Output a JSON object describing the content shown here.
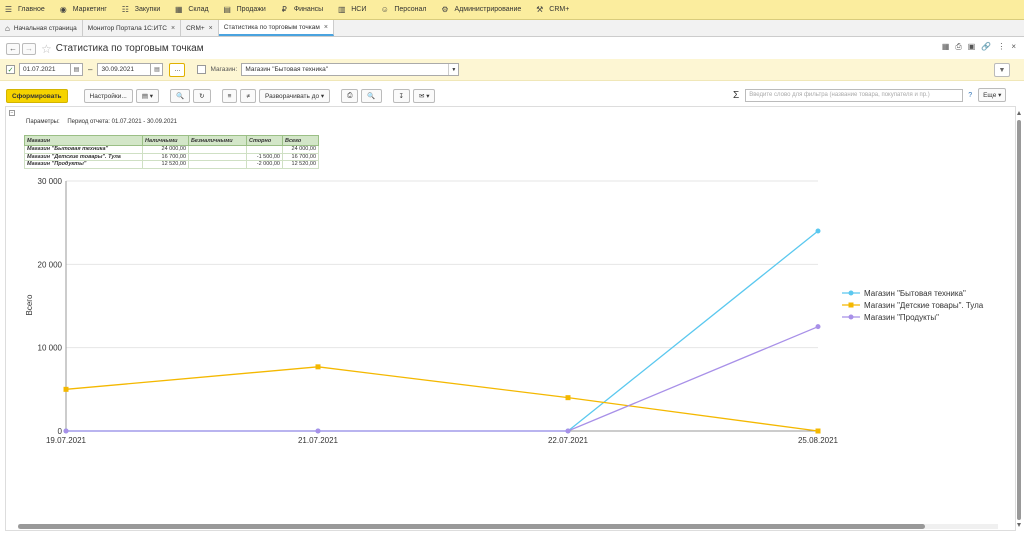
{
  "topmenu": [
    {
      "icon": "menu-icon",
      "label": "Главное"
    },
    {
      "icon": "marketing-icon",
      "label": "Маркетинг"
    },
    {
      "icon": "purchases-icon",
      "label": "Закупки"
    },
    {
      "icon": "warehouse-icon",
      "label": "Склад"
    },
    {
      "icon": "sales-icon",
      "label": "Продажи"
    },
    {
      "icon": "finance-icon",
      "label": "Финансы"
    },
    {
      "icon": "nsi-icon",
      "label": "НСИ"
    },
    {
      "icon": "personnel-icon",
      "label": "Персонал"
    },
    {
      "icon": "admin-icon",
      "label": "Администрирование"
    },
    {
      "icon": "crm-icon",
      "label": "CRM+"
    }
  ],
  "tabs": [
    {
      "label": "Начальная страница",
      "closable": false,
      "home": true
    },
    {
      "label": "Монитор Портала 1С:ИТС",
      "closable": true
    },
    {
      "label": "CRM+",
      "closable": true
    },
    {
      "label": "Статистика по торговым точкам",
      "closable": true,
      "active": true
    }
  ],
  "page": {
    "title": "Статистика по торговым точкам"
  },
  "filter": {
    "date_from": "01.07.2021",
    "date_to": "30.09.2021",
    "dots": "...",
    "shop_label": "Магазин:",
    "shop_value": "Магазин \"Бытовая техника\""
  },
  "toolbar": {
    "generate": "Сформировать",
    "settings": "Настройки...",
    "expand": "Разворачивать до",
    "search_placeholder": "Введите слово для фильтра (название товара, покупателя и пр.)",
    "help": "?",
    "more": "Еще"
  },
  "report": {
    "params_label": "Параметры:",
    "params_value": "Период отчета: 01.07.2021 - 30.09.2021",
    "table": {
      "headers": [
        "Магазин",
        "Наличными",
        "Безналичными",
        "Сторно",
        "Всего"
      ],
      "rows": [
        [
          "Магазин \"Бытовая техника\"",
          "24 000,00",
          "",
          "",
          "24 000,00"
        ],
        [
          "Магазин \"Детские товары\". Тула",
          "16 700,00",
          "",
          "-1 500,00",
          "16 700,00"
        ],
        [
          "Магазин \"Продукты\"",
          "12 520,00",
          "",
          "-2 000,00",
          "12 520,00"
        ]
      ]
    }
  },
  "chart_data": {
    "type": "line",
    "categories": [
      "19.07.2021",
      "21.07.2021",
      "22.07.2021",
      "25.08.2021"
    ],
    "ylabel": "Всего",
    "ylim": [
      0,
      30000
    ],
    "yticks": [
      "0",
      "10 000",
      "20 000",
      "30 000"
    ],
    "legend_position": "right",
    "series": [
      {
        "name": "Магазин \"Бытовая техника\"",
        "color": "#5bc8ef",
        "marker": "circle",
        "values": [
          0,
          0,
          0,
          24000
        ]
      },
      {
        "name": "Магазин \"Детские товары\". Тула",
        "color": "#f4b800",
        "marker": "square",
        "values": [
          5000,
          7700,
          4000,
          0
        ]
      },
      {
        "name": "Магазин \"Продукты\"",
        "color": "#a890e8",
        "marker": "circle",
        "values": [
          0,
          0,
          0,
          12520
        ]
      }
    ]
  }
}
